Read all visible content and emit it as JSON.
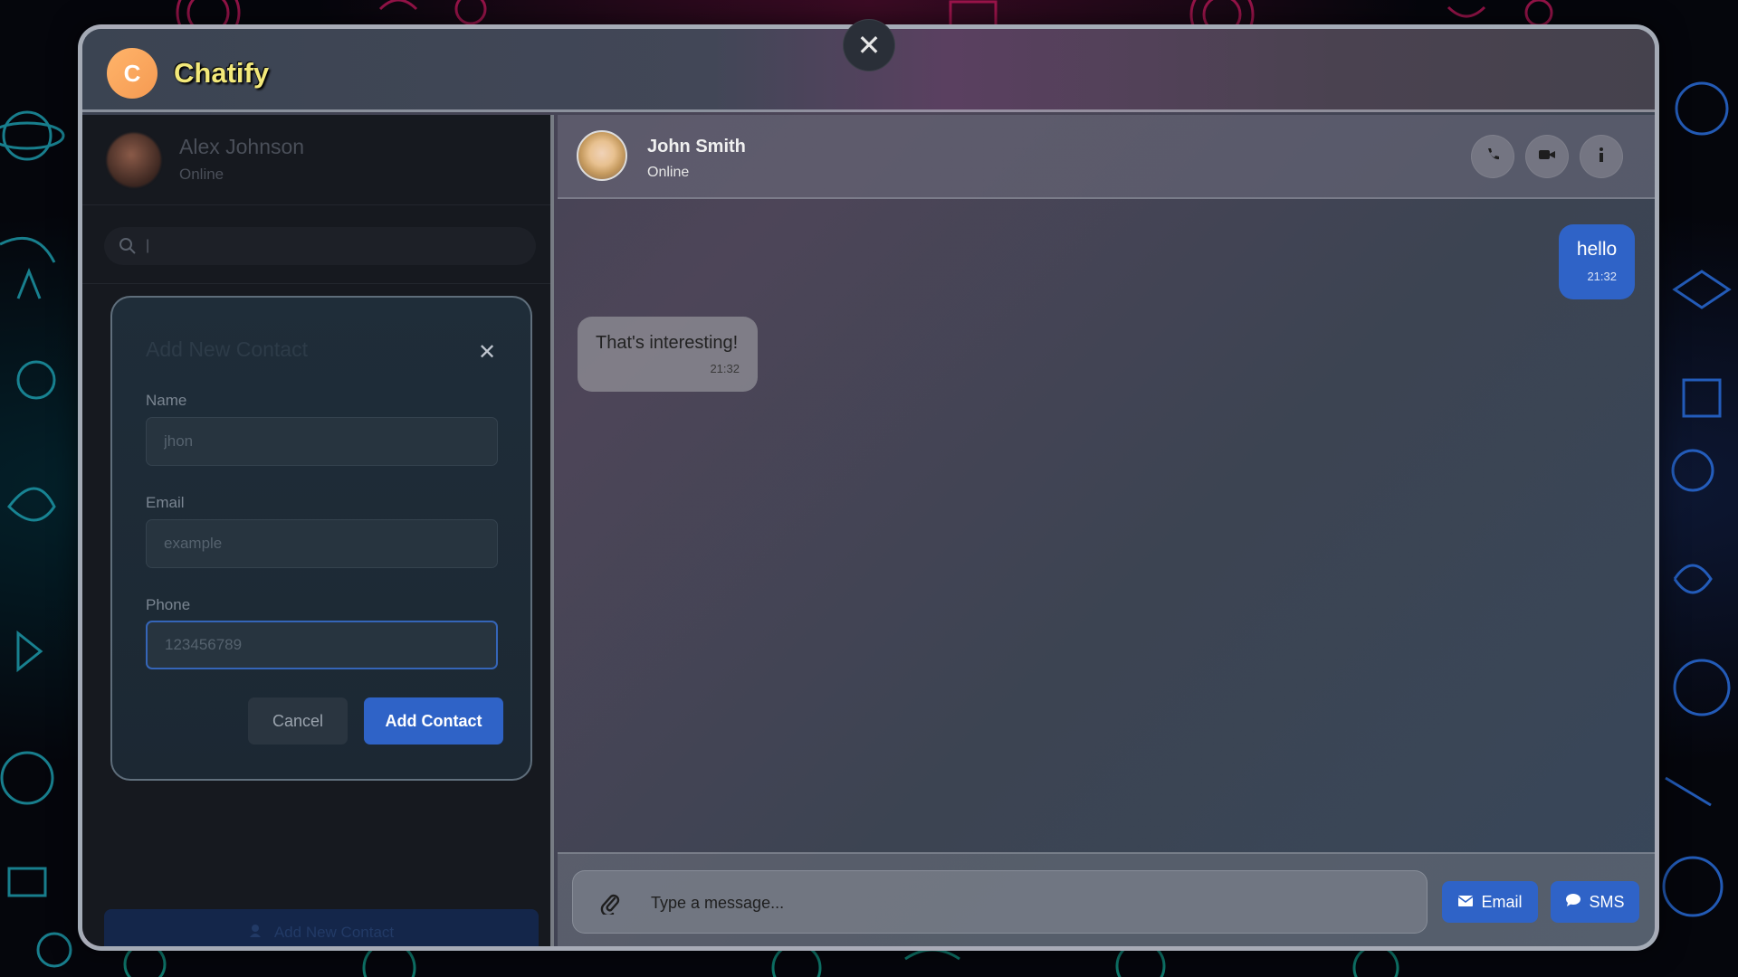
{
  "app": {
    "logo_letter": "C",
    "name": "Chatify"
  },
  "sidebar": {
    "profile_name": "Alex Johnson",
    "profile_status": "Online",
    "search_value": "|",
    "add_new_contact_label": "Add New Contact"
  },
  "modal": {
    "title": "Add New Contact",
    "name_label": "Name",
    "name_value": "jhon",
    "email_label": "Email",
    "email_value": "example",
    "phone_label": "Phone",
    "phone_value": "123456789",
    "cancel_label": "Cancel",
    "submit_label": "Add Contact"
  },
  "chat": {
    "contact_name": "John Smith",
    "contact_status": "Online",
    "messages": [
      {
        "direction": "out",
        "text": "hello",
        "time": "21:32"
      },
      {
        "direction": "in",
        "text": "That's interesting!",
        "time": "21:32"
      }
    ],
    "composer_placeholder": "Type a message...",
    "email_label": "Email",
    "sms_label": "SMS"
  },
  "colors": {
    "accent": "#2f63c7",
    "logo_gradient_start": "#ffb46a",
    "logo_text": "#f3e97a"
  }
}
